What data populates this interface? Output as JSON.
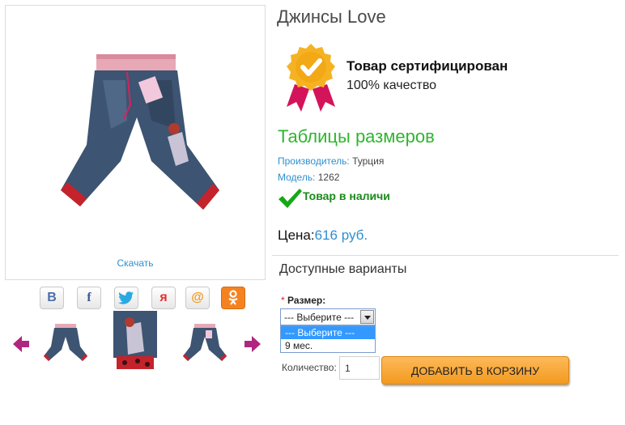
{
  "product": {
    "title": "Джинсы Love",
    "download_label": "Скачать"
  },
  "share": {
    "icons": [
      "vk-icon",
      "facebook-icon",
      "twitter-icon",
      "odnoklassniki-ya-icon",
      "mail-icon",
      "ok-icon"
    ],
    "vk_glyph": "B",
    "facebook_glyph": "f",
    "ya_glyph": "я",
    "mail_glyph": "@"
  },
  "certificate": {
    "title": "Товар сертифицирован",
    "subtitle": "100% качество"
  },
  "size_tables_link": "Таблицы размеров",
  "details": {
    "manufacturer_label": "Производитель:",
    "manufacturer_value": "Турция",
    "model_label": "Модель:",
    "model_value": "1262",
    "stock_text": "Товар в наличи"
  },
  "price": {
    "label": "Цена:",
    "value": "616 руб."
  },
  "variants": {
    "title": "Доступные варианты",
    "size_label": "Размер:",
    "required_mark": "*",
    "selected": "--- Выберите ---",
    "options": [
      "--- Выберите ---",
      "9 мес."
    ]
  },
  "quantity": {
    "label": "Количество:",
    "value": "1"
  },
  "cart_button_label": "ДОБАВИТЬ В КОРЗИНУ",
  "colors": {
    "link_blue": "#2e8fd0",
    "green_heading": "#2fb52f",
    "stock_green": "#1a8a1a",
    "button_orange": "#f39a1e",
    "arrow_purple": "#b0267f",
    "badge_gold": "#f5b323",
    "ribbon_red": "#d4145a"
  }
}
